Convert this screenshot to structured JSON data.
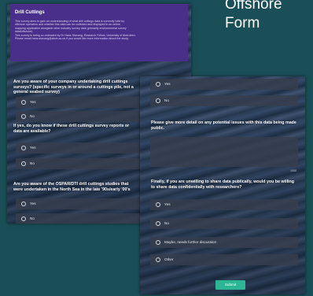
{
  "slide": {
    "title": "Offshore Form"
  },
  "form_left": {
    "header_title": "Drill Cuttings",
    "header_text": [
      "This survey aims to gain an understanding of what drill cuttings data is currently held by",
      "offshore operators and whether this data can be collected and displayed in an online",
      "mapping application alongside other industry survey data (primarily environmental survey",
      "data/offshore).",
      "This survey is being co-ordinated by Dr Hans Stavang, Research Fellow, University of Aberdeen.",
      "Please email hans.stavang@abdn.ac.uk if you would like more information about the study."
    ],
    "q1": "Are you aware of your company undertaking drill cuttings surveys? (specific surveys in or around a cuttings pile, not a general seabed survey)",
    "q1_options": [
      "Yes",
      "No"
    ],
    "q2": "If yes, do you know if these drill cuttings survey reports or data are available?",
    "q2_options": [
      "Yes",
      "No"
    ],
    "q3": "Are you aware of the OSPAR/DTI drill cuttings studies that were undertaken in the North Sea in the late '90s/early '00's",
    "q3_options": [
      "Yes",
      "No"
    ]
  },
  "form_right": {
    "top_options": [
      "Yes",
      "No"
    ],
    "q4": "Please give more detail on any potential issues with this data being made public.",
    "char_counter": "1000",
    "q5": "Finally, if you are unwilling to share data publically, would you be willing to share data confidentially with researchers?",
    "q5_options": [
      "Yes",
      "No",
      "Maybe, needs further discussion",
      "Other"
    ],
    "submit_label": "Submit"
  },
  "colors": {
    "header_purple": "#4a2f8a",
    "submit_green": "#2bb796",
    "slide_bg": "#1a4f58"
  }
}
